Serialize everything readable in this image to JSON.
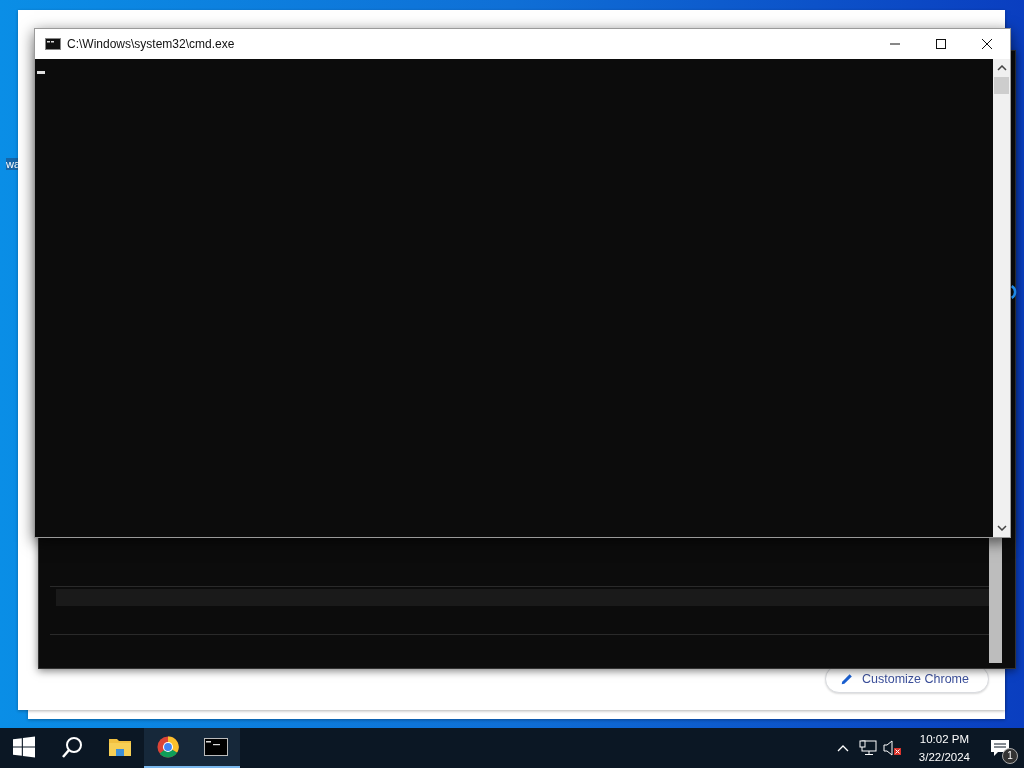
{
  "desktop": {
    "icon_label": "wa"
  },
  "browser_window": {
    "customize_button": "Customize Chrome"
  },
  "console_window": {
    "title": "C:\\Windows\\system32\\cmd.exe"
  },
  "taskbar": {
    "apps": [
      {
        "kind": "folder",
        "running": false
      },
      {
        "kind": "browser",
        "running": true
      },
      {
        "kind": "terminal",
        "running": true
      }
    ],
    "tray": {
      "muted": true,
      "time": "10:02 PM",
      "date": "3/22/2024",
      "notification_count": "1"
    }
  }
}
